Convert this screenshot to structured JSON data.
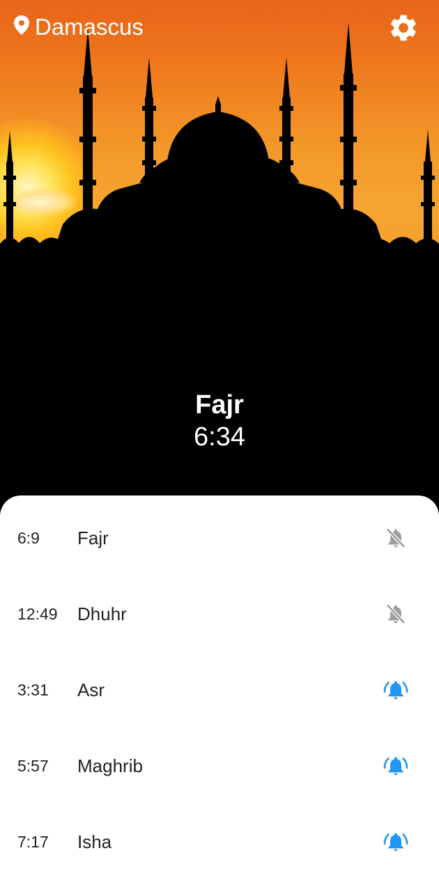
{
  "header": {
    "location": "Damascus",
    "location_icon": "map-pin-icon",
    "settings_icon": "gear-icon"
  },
  "current_prayer": {
    "name": "Fajr",
    "time": "6:34"
  },
  "prayers": [
    {
      "time": "6:9",
      "name": "Fajr",
      "alarm": "off"
    },
    {
      "time": "12:49",
      "name": "Dhuhr",
      "alarm": "off"
    },
    {
      "time": "3:31",
      "name": "Asr",
      "alarm": "on"
    },
    {
      "time": "5:57",
      "name": "Maghrib",
      "alarm": "on"
    },
    {
      "time": "7:17",
      "name": "Isha",
      "alarm": "on"
    }
  ],
  "colors": {
    "alarm_on": "#2196f3",
    "alarm_off": "#9e9e9e",
    "sky": "#f07a1e",
    "panel": "#ffffff"
  }
}
